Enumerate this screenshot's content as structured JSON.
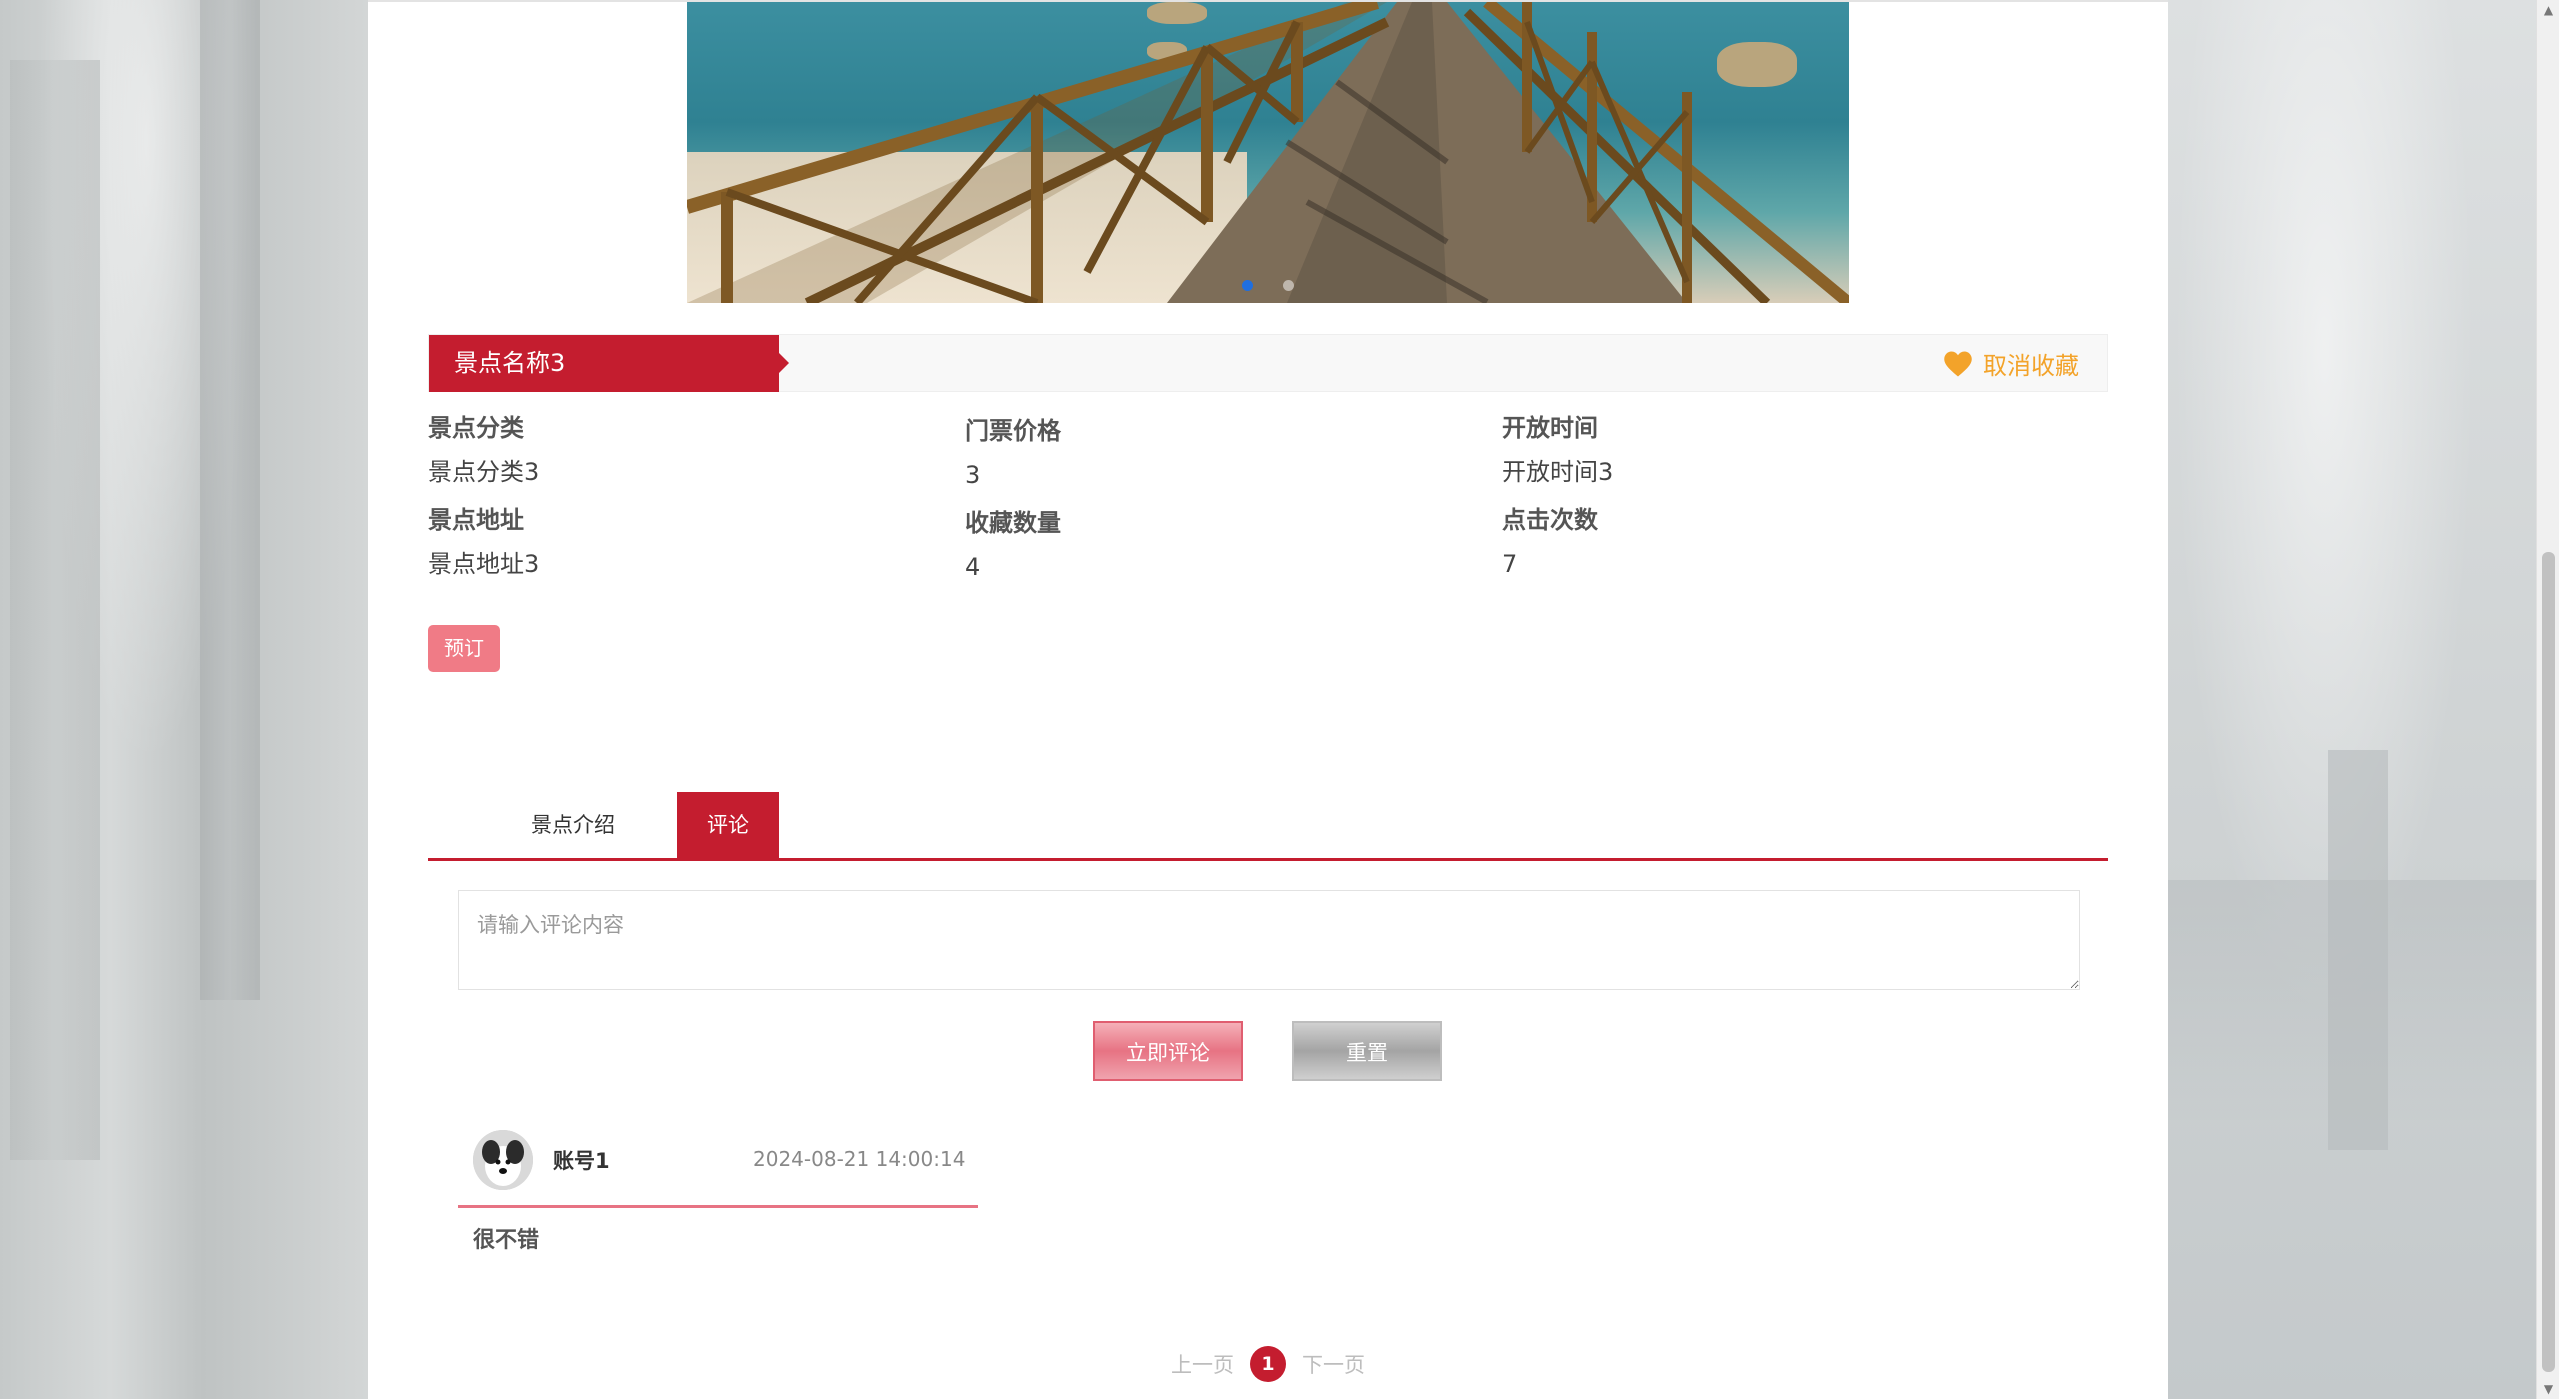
{
  "attraction": {
    "name": "景点名称3",
    "favorite_label": "取消收藏",
    "book_label": "预订"
  },
  "details": {
    "category_label": "景点分类",
    "category_value": "景点分类3",
    "address_label": "景点地址",
    "address_value": "景点地址3",
    "price_label": "门票价格",
    "price_value": "3",
    "favorites_label": "收藏数量",
    "favorites_value": "4",
    "open_time_label": "开放时间",
    "open_time_value": "开放时间3",
    "clicks_label": "点击次数",
    "clicks_value": "7"
  },
  "tabs": [
    {
      "label": "景点介绍",
      "active": false
    },
    {
      "label": "评论",
      "active": true
    }
  ],
  "comment_form": {
    "placeholder": "请输入评论内容",
    "submit_label": "立即评论",
    "reset_label": "重置"
  },
  "comments": [
    {
      "user": "账号1",
      "time": "2024-08-21 14:00:14",
      "text": "很不错"
    }
  ],
  "pagination": {
    "prev_label": "上一页",
    "current_page": "1",
    "next_label": "下一页"
  },
  "carousel": {
    "slide_count": 2,
    "active_index": 0
  },
  "colors": {
    "accent": "#c41d2f",
    "favorite": "#f3a32a",
    "book_button": "#f07b86",
    "carousel_active_dot": "#1f6fe0"
  }
}
